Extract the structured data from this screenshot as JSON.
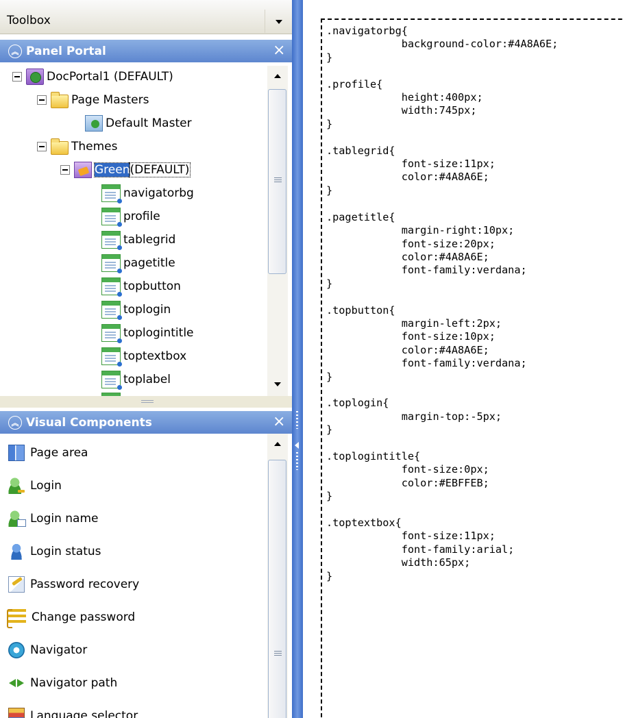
{
  "toolbox": {
    "title": "Toolbox"
  },
  "panel_portal": {
    "title": "Panel Portal",
    "close": "×",
    "tree": {
      "portal": {
        "label": "DocPortal1 (DEFAULT)"
      },
      "page_masters": {
        "label": "Page Masters"
      },
      "default_master": {
        "label": "Default Master"
      },
      "themes": {
        "label": "Themes"
      },
      "theme_green": {
        "label": "Green",
        "suffix": " (DEFAULT)"
      },
      "styles": [
        "navigatorbg",
        "profile",
        "tablegrid",
        "pagetitle",
        "topbutton",
        "toplogin",
        "toplogintitle",
        "toptextbox",
        "toplabel"
      ]
    }
  },
  "visual_components": {
    "title": "Visual Components",
    "close": "×",
    "items": [
      "Page area",
      "Login",
      "Login name",
      "Login status",
      "Password recovery",
      "Change password",
      "Navigator",
      "Navigator path",
      "Language selector"
    ]
  },
  "editor": {
    "code": ".navigatorbg{\n\t\tbackground-color:#4A8A6E;\n}\n\n.profile{\n\t\theight:400px;\n\t\twidth:745px;\n}\n\n.tablegrid{\n\t\tfont-size:11px;\n\t\tcolor:#4A8A6E;\n}\n\n.pagetitle{\n\t\tmargin-right:10px;\n\t\tfont-size:20px;\n\t\tcolor:#4A8A6E;\n\t\tfont-family:verdana;\n}\n\n.topbutton{\n\t\tmargin-left:2px;\n\t\tfont-size:10px;\n\t\tcolor:#4A8A6E;\n\t\tfont-family:verdana;\n}\n\n.toplogin{\n\t\tmargin-top:-5px;\n}\n\n.toplogintitle{\n\t\tfont-size:0px;\n\t\tcolor:#EBFFEB;\n}\n\n.toptextbox{\n\t\tfont-size:11px;\n\t\tfont-family:arial;\n\t\twidth:65px;\n}"
  },
  "colors": {
    "panel_header": "#5d86cf",
    "selection": "#316ac5",
    "splitter": "#3f6fc9"
  }
}
